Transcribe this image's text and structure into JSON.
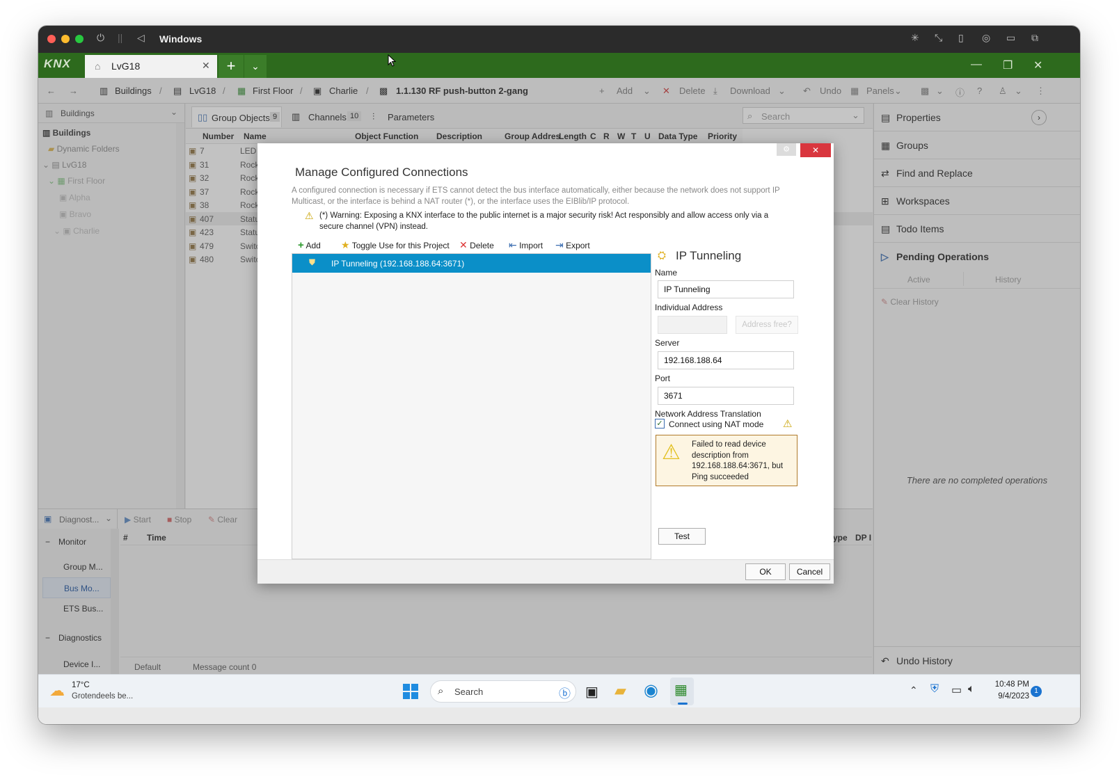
{
  "mac": {
    "title": "Windows"
  },
  "knx": {
    "logo": "KNX",
    "tab_label": "LvG18",
    "crumbs": [
      "Buildings",
      "LvG18",
      "First Floor",
      "Charlie",
      "1.1.130 RF push-button 2-gang"
    ],
    "toolbar": {
      "add": "Add",
      "delete": "Delete",
      "download": "Download",
      "undo": "Undo",
      "panels": "Panels"
    }
  },
  "left": {
    "dropdown": "Buildings",
    "header": "Buildings",
    "items": [
      "Dynamic Folders",
      "LvG18",
      "First Floor",
      "Alpha",
      "Bravo",
      "Charlie"
    ]
  },
  "center": {
    "tabs": [
      {
        "label": "Group Objects",
        "count": "9"
      },
      {
        "label": "Channels",
        "count": "10"
      },
      {
        "label": "Parameters",
        "count": ""
      }
    ],
    "search_placeholder": "Search",
    "columns": [
      "Number",
      "Name",
      "Object Function",
      "Description",
      "Group Addres",
      "Length",
      "C",
      "R",
      "W",
      "T",
      "U",
      "Data Type",
      "Priority"
    ],
    "rows": [
      {
        "number": "7",
        "name": "LED"
      },
      {
        "number": "31",
        "name": "Rock"
      },
      {
        "number": "32",
        "name": "Rock"
      },
      {
        "number": "37",
        "name": "Rock"
      },
      {
        "number": "38",
        "name": "Rock"
      },
      {
        "number": "407",
        "name": "Statu"
      },
      {
        "number": "423",
        "name": "Statu"
      },
      {
        "number": "479",
        "name": "Switc"
      },
      {
        "number": "480",
        "name": "Switc"
      }
    ]
  },
  "right": {
    "items": [
      "Properties",
      "Groups",
      "Find and Replace",
      "Workspaces",
      "Todo Items",
      "Pending Operations"
    ],
    "subtabs": [
      "Active",
      "History"
    ],
    "clear_history": "Clear History",
    "empty_text": "There are no completed operations",
    "undo_history": "Undo History"
  },
  "bottom": {
    "dropdown": "Diagnost...",
    "start": "Start",
    "stop": "Stop",
    "clear": "Clear",
    "groups": [
      {
        "title": "Monitor",
        "items": [
          "Group M...",
          "Bus Mo...",
          "ETS Bus..."
        ]
      },
      {
        "title": "Diagnostics",
        "items": [
          "Device I..."
        ]
      }
    ],
    "cols": [
      "#",
      "Time"
    ],
    "cols_right": [
      "ype",
      "DP I"
    ],
    "status_default": "Default",
    "message_count": "Message count 0"
  },
  "dialog": {
    "title": "Manage Configured Connections",
    "intro": "A configured connection is necessary if ETS cannot detect the bus interface automatically, either because the network does not support IP Multicast, or the interface is behind a NAT router (*), or the interface uses the EIBlib/IP protocol.",
    "warning": "(*) Warning: Exposing a KNX interface to the public internet is a major security risk! Act responsibly and allow access only via a secure channel (VPN) instead.",
    "toolbar": {
      "add": "Add",
      "toggle": "Toggle Use for this Project",
      "delete": "Delete",
      "import": "Import",
      "export": "Export"
    },
    "connections": [
      "IP Tunneling (192.168.188.64:3671)"
    ],
    "detail": {
      "heading": "IP Tunneling",
      "name_label": "Name",
      "name_value": "IP Tunneling",
      "ia_label": "Individual Address",
      "ia_value": "",
      "address_free": "Address free?",
      "server_label": "Server",
      "server_value": "192.168.188.64",
      "port_label": "Port",
      "port_value": "3671",
      "nat_label": "Network Address Translation",
      "nat_checkbox": "Connect using NAT mode",
      "nat_checked": true,
      "error_text": "Failed to read device description from 192.168.188.64:3671, but Ping succeeded",
      "test": "Test"
    },
    "ok": "OK",
    "cancel": "Cancel"
  },
  "taskbar": {
    "temp": "17°C",
    "weather": "Grotendeels be...",
    "search": "Search",
    "time": "10:48 PM",
    "date": "9/4/2023",
    "badge": "1"
  },
  "colors": {
    "knx_green": "#2d6a1d",
    "selection": "#0b8fc8",
    "close_red": "#d9363e"
  }
}
